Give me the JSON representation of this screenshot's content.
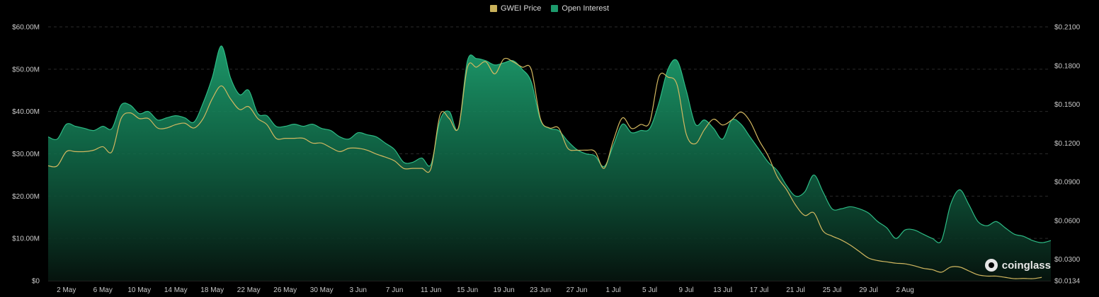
{
  "legend": {
    "items": [
      {
        "label": "GWEI Price",
        "color": "#c9b15a"
      },
      {
        "label": "Open Interest",
        "color": "#1d9a6c"
      }
    ]
  },
  "watermark": "coinglass",
  "chart_data": {
    "type": "area",
    "x_ticks": [
      "2 May",
      "6 May",
      "10 May",
      "14 May",
      "18 May",
      "22 May",
      "26 May",
      "30 May",
      "3 Jun",
      "7 Jun",
      "11 Jun",
      "15 Jun",
      "19 Jun",
      "23 Jun",
      "27 Jun",
      "1 Jul",
      "5 Jul",
      "9 Jul",
      "13 Jul",
      "17 Jul",
      "21 Jul",
      "25 Jul",
      "29 Jul",
      "2 Aug"
    ],
    "y_left_ticks": [
      "$0",
      "$10.00M",
      "$20.00M",
      "$30.00M",
      "$40.00M",
      "$50.00M",
      "$60.00M"
    ],
    "y_right_ticks": [
      "$0.0134",
      "$0.0300",
      "$0.0600",
      "$0.0900",
      "$0.1200",
      "$0.1500",
      "$0.1800",
      "$0.2100"
    ],
    "y_left_range": [
      0,
      60
    ],
    "y_right_range": [
      0.0134,
      0.21
    ],
    "grid": true,
    "legend_position": "top-center",
    "x_start": "2024-04-30",
    "series": [
      {
        "name": "Open Interest",
        "axis": "left",
        "unit": "$M",
        "color": "#1d9a6c",
        "values": [
          34,
          33.5,
          37,
          36.5,
          36,
          35.5,
          36.5,
          36,
          41.5,
          41.5,
          39.5,
          40,
          38,
          38.5,
          39,
          38.5,
          37.5,
          42,
          48,
          55.5,
          48,
          44,
          45,
          39.5,
          39,
          36.5,
          36.5,
          37,
          36.5,
          37,
          36,
          35.5,
          34,
          33.5,
          35,
          34.5,
          34,
          32.5,
          31,
          28,
          28,
          29,
          27.5,
          38,
          40,
          36,
          52,
          52.5,
          52,
          51,
          51.5,
          52,
          50,
          47,
          38,
          36,
          35.5,
          33,
          31,
          30,
          29.5,
          27,
          32,
          37,
          35,
          35.5,
          36,
          42,
          50,
          52,
          45,
          37,
          38,
          36,
          33.5,
          38,
          37,
          34,
          31,
          28,
          26,
          22.5,
          20,
          21,
          25,
          21,
          17,
          17,
          17.5,
          17,
          16,
          14,
          12.5,
          10,
          12,
          12,
          11,
          10,
          9.5,
          18,
          21.5,
          18,
          14,
          13,
          14,
          12.5,
          11,
          10.5,
          9.5,
          9,
          9.5
        ]
      },
      {
        "name": "GWEI Price",
        "axis": "right",
        "unit": "$",
        "color": "#c9b15a",
        "values": [
          0.1024,
          0.1024,
          0.1134,
          0.1134,
          0.1134,
          0.1145,
          0.1172,
          0.1134,
          0.139,
          0.1434,
          0.139,
          0.139,
          0.1317,
          0.1317,
          0.1343,
          0.1354,
          0.1317,
          0.139,
          0.1543,
          0.1643,
          0.1543,
          0.146,
          0.1482,
          0.139,
          0.1343,
          0.1237,
          0.1237,
          0.1237,
          0.1237,
          0.12,
          0.12,
          0.1165,
          0.1134,
          0.116,
          0.116,
          0.1145,
          0.1115,
          0.1091,
          0.1062,
          0.1004,
          0.1004,
          0.1004,
          0.1004,
          0.142,
          0.139,
          0.1317,
          0.1788,
          0.1788,
          0.183,
          0.1736,
          0.1852,
          0.183,
          0.1788,
          0.177,
          0.139,
          0.1317,
          0.1317,
          0.116,
          0.1145,
          0.1145,
          0.1134,
          0.1005,
          0.1219,
          0.1395,
          0.1313,
          0.1344,
          0.1363,
          0.1715,
          0.1711,
          0.165,
          0.127,
          0.1195,
          0.1305,
          0.1385,
          0.134,
          0.138,
          0.144,
          0.1368,
          0.122,
          0.11,
          0.0938,
          0.084,
          0.072,
          0.064,
          0.066,
          0.052,
          0.048,
          0.045,
          0.041,
          0.036,
          0.031,
          0.029,
          0.028,
          0.027,
          0.0265,
          0.025,
          0.023,
          0.022,
          0.02,
          0.024,
          0.024,
          0.021,
          0.018,
          0.017,
          0.017,
          0.016,
          0.015,
          0.0152,
          0.015,
          0.016
        ]
      }
    ]
  }
}
